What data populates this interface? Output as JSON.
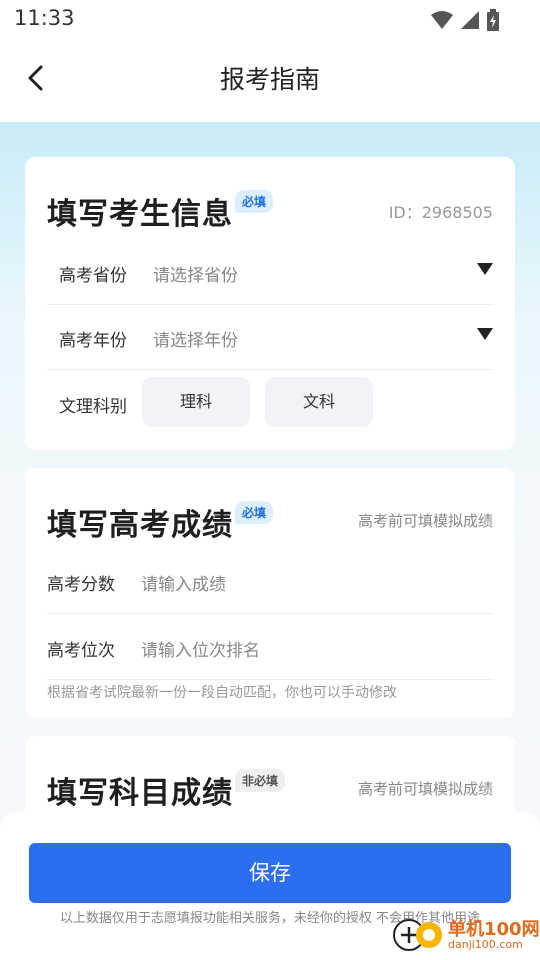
{
  "status": {
    "time": "11:33"
  },
  "header": {
    "title": "报考指南"
  },
  "candidate_info": {
    "title": "填写考生信息",
    "badge": "必填",
    "id_label": "ID：2968505",
    "province": {
      "label": "高考省份",
      "placeholder": "请选择省份"
    },
    "year": {
      "label": "高考年份",
      "placeholder": "请选择年份"
    },
    "stream": {
      "label": "文理科别",
      "options": [
        "理科",
        "文科"
      ]
    }
  },
  "score_info": {
    "title": "填写高考成绩",
    "badge": "必填",
    "hint": "高考前可填模拟成绩",
    "score": {
      "label": "高考分数",
      "placeholder": "请输入成绩"
    },
    "rank": {
      "label": "高考位次",
      "placeholder": "请输入位次排名"
    },
    "note": "根据省考试院最新一份一段自动匹配，你也可以手动修改"
  },
  "subject_info": {
    "title": "填写科目成绩",
    "badge": "非必填",
    "hint": "高考前可填模拟成绩"
  },
  "footer": {
    "save_label": "保存",
    "disclaimer": "以上数据仅用于志愿填报功能相关服务，未经你的授权 不会用作其他用途"
  },
  "watermark": {
    "name": "单机100网",
    "url": "danji100.com"
  },
  "colors": {
    "accent": "#2b6ff0",
    "badge_bg": "#dcefff",
    "watermark": "#e06a1b"
  }
}
